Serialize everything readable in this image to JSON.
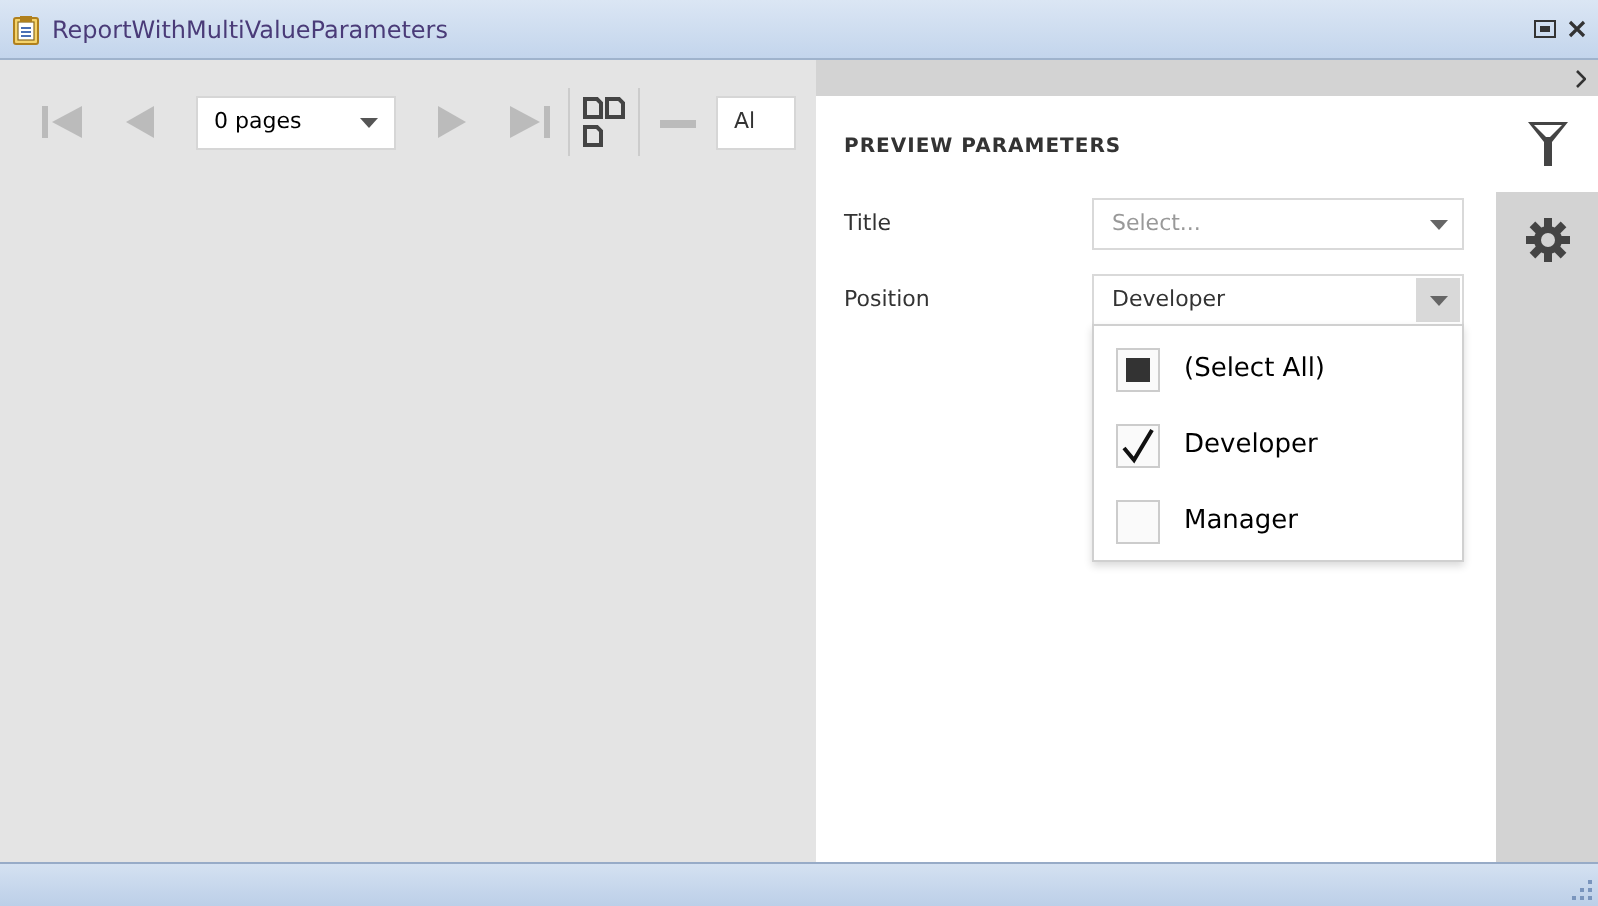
{
  "window": {
    "title": "ReportWithMultiValueParameters"
  },
  "toolbar": {
    "pages_select": "0 pages",
    "zoom_field": "Al"
  },
  "panel": {
    "heading": "PREVIEW PARAMETERS",
    "parameters": [
      {
        "label": "Title",
        "placeholder": "Select...",
        "open": false
      },
      {
        "label": "Position",
        "value": "Developer",
        "open": true
      }
    ],
    "dropdown_items": [
      {
        "label": "(Select All)",
        "checked": false,
        "indeterminate": true
      },
      {
        "label": "Developer",
        "checked": true,
        "indeterminate": false
      },
      {
        "label": "Manager",
        "checked": false,
        "indeterminate": false
      }
    ]
  },
  "side_tabs": [
    {
      "kind": "filter",
      "selected": true
    },
    {
      "kind": "settings",
      "selected": false
    }
  ]
}
